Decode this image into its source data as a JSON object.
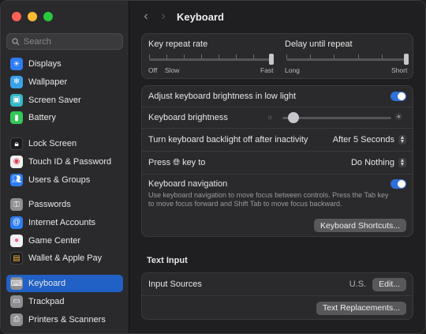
{
  "sidebar": {
    "search_placeholder": "Search",
    "items": [
      {
        "label": "Displays",
        "icon": "sun-icon",
        "color": "#2e7cf6"
      },
      {
        "label": "Wallpaper",
        "icon": "snowflake-icon",
        "color": "#3aa0e8"
      },
      {
        "label": "Screen Saver",
        "icon": "screen-saver-icon",
        "color": "#35b8c8"
      },
      {
        "label": "Battery",
        "icon": "battery-icon",
        "color": "#34c759"
      },
      {
        "label": "Lock Screen",
        "icon": "lock-icon",
        "color": "#1c1c1e"
      },
      {
        "label": "Touch ID & Password",
        "icon": "fingerprint-icon",
        "color": "#f2f2f2"
      },
      {
        "label": "Users & Groups",
        "icon": "users-icon",
        "color": "#2e7cf6"
      },
      {
        "label": "Passwords",
        "icon": "key-icon",
        "color": "#8e8e93"
      },
      {
        "label": "Internet Accounts",
        "icon": "at-icon",
        "color": "#2e7cf6"
      },
      {
        "label": "Game Center",
        "icon": "game-center-icon",
        "color": "#f2f2f2"
      },
      {
        "label": "Wallet & Apple Pay",
        "icon": "wallet-icon",
        "color": "#1c1c1e"
      },
      {
        "label": "Keyboard",
        "icon": "keyboard-icon",
        "color": "#8e8e93"
      },
      {
        "label": "Trackpad",
        "icon": "trackpad-icon",
        "color": "#8e8e93"
      },
      {
        "label": "Printers & Scanners",
        "icon": "printer-icon",
        "color": "#8e8e93"
      }
    ]
  },
  "header": {
    "title": "Keyboard"
  },
  "repeat": {
    "key_repeat_label": "Key repeat rate",
    "delay_label": "Delay until repeat",
    "key_repeat_left": "Off",
    "key_repeat_left2": "Slow",
    "key_repeat_right": "Fast",
    "delay_left": "Long",
    "delay_right": "Short",
    "key_repeat_level": 1.0,
    "delay_level": 1.0
  },
  "settings": {
    "adjust_brightness_label": "Adjust keyboard brightness in low light",
    "adjust_brightness_on": true,
    "brightness_label": "Keyboard brightness",
    "brightness_level": 0.1,
    "backlight_off_label": "Turn keyboard backlight off after inactivity",
    "backlight_off_value": "After 5 Seconds",
    "press_key_label_1": "Press",
    "press_key_label_2": "key to",
    "press_key_value": "Do Nothing",
    "keyboard_nav_label": "Keyboard navigation",
    "keyboard_nav_desc": "Use keyboard navigation to move focus between controls. Press the Tab key to move focus forward and Shift Tab to move focus backward.",
    "keyboard_nav_on": true,
    "shortcuts_button": "Keyboard Shortcuts..."
  },
  "text_input": {
    "section_title": "Text Input",
    "input_sources_label": "Input Sources",
    "input_sources_value": "U.S.",
    "edit_button": "Edit...",
    "replacements_button": "Text Replacements..."
  },
  "colors": {
    "accent": "#2160c4",
    "toggle": "#2f6fd8"
  }
}
